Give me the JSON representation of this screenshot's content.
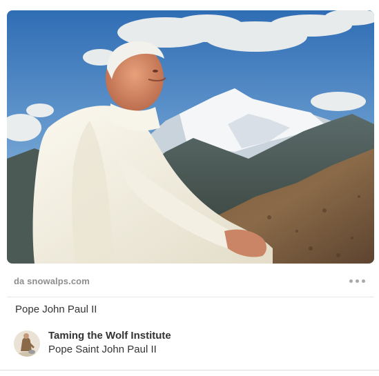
{
  "pin": {
    "image": {
      "alt": "Pope John Paul II",
      "icon": "photo-mountain-portrait"
    },
    "source": "da snowalps.com",
    "more_icon": "ellipsis-icon",
    "title": "Pope John Paul II",
    "pinner": {
      "name": "Taming the Wolf Institute",
      "board": "Pope Saint John Paul II",
      "avatar_icon": "avatar-figure"
    }
  },
  "colors": {
    "source_text": "#8e8e8e",
    "primary_text": "#333333",
    "divider": "#e6e6e6",
    "dots": "#a9a9a9"
  }
}
